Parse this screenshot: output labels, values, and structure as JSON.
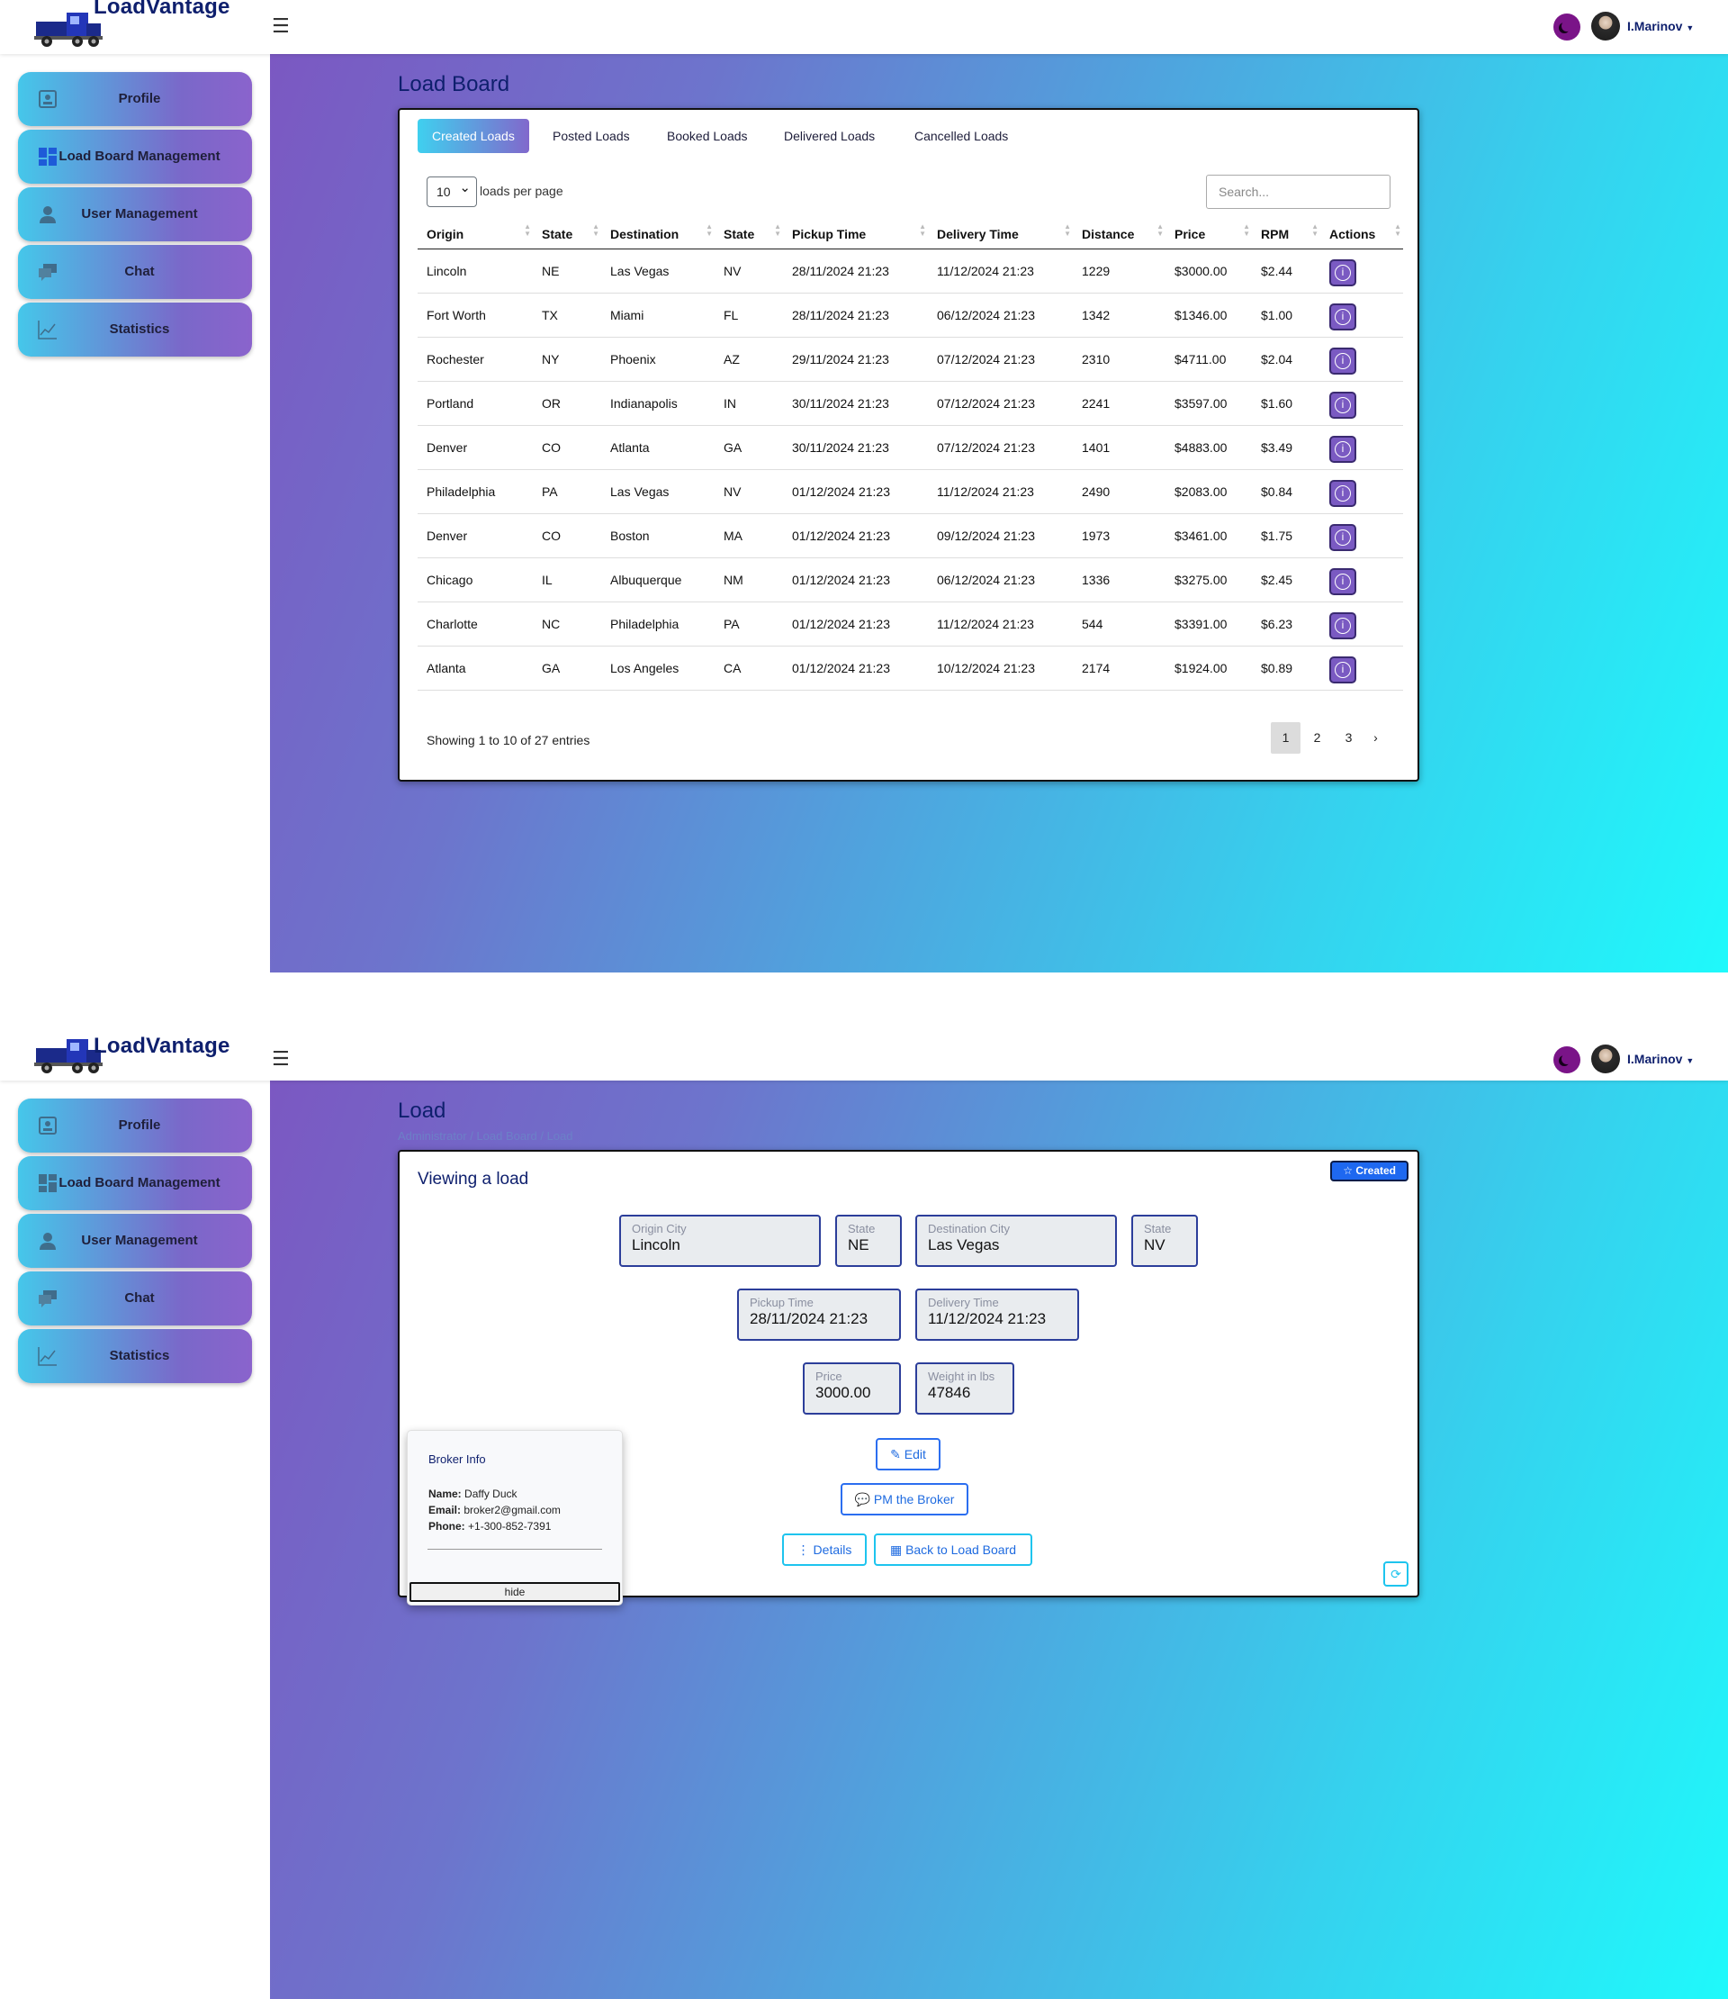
{
  "app": {
    "brand": "LoadVantage",
    "username": "I.Marinov"
  },
  "sidebar": {
    "items": [
      {
        "label": "Profile",
        "icon": "profile-icon"
      },
      {
        "label": "Load Board Management",
        "icon": "grid-icon"
      },
      {
        "label": "User Management",
        "icon": "user-icon"
      },
      {
        "label": "Chat",
        "icon": "chat-icon"
      },
      {
        "label": "Statistics",
        "icon": "chart-icon"
      }
    ]
  },
  "loadboard": {
    "title": "Load Board",
    "tabs": [
      "Created Loads",
      "Posted Loads",
      "Booked Loads",
      "Delivered Loads",
      "Cancelled Loads"
    ],
    "per_page_value": "10",
    "per_page_label": "loads per page",
    "search_placeholder": "Search...",
    "columns": [
      "Origin",
      "State",
      "Destination",
      "State",
      "Pickup Time",
      "Delivery Time",
      "Distance",
      "Price",
      "RPM",
      "Actions"
    ],
    "rows": [
      [
        "Lincoln",
        "NE",
        "Las Vegas",
        "NV",
        "28/11/2024 21:23",
        "11/12/2024 21:23",
        "1229",
        "$3000.00",
        "$2.44"
      ],
      [
        "Fort Worth",
        "TX",
        "Miami",
        "FL",
        "28/11/2024 21:23",
        "06/12/2024 21:23",
        "1342",
        "$1346.00",
        "$1.00"
      ],
      [
        "Rochester",
        "NY",
        "Phoenix",
        "AZ",
        "29/11/2024 21:23",
        "07/12/2024 21:23",
        "2310",
        "$4711.00",
        "$2.04"
      ],
      [
        "Portland",
        "OR",
        "Indianapolis",
        "IN",
        "30/11/2024 21:23",
        "07/12/2024 21:23",
        "2241",
        "$3597.00",
        "$1.60"
      ],
      [
        "Denver",
        "CO",
        "Atlanta",
        "GA",
        "30/11/2024 21:23",
        "07/12/2024 21:23",
        "1401",
        "$4883.00",
        "$3.49"
      ],
      [
        "Philadelphia",
        "PA",
        "Las Vegas",
        "NV",
        "01/12/2024 21:23",
        "11/12/2024 21:23",
        "2490",
        "$2083.00",
        "$0.84"
      ],
      [
        "Denver",
        "CO",
        "Boston",
        "MA",
        "01/12/2024 21:23",
        "09/12/2024 21:23",
        "1973",
        "$3461.00",
        "$1.75"
      ],
      [
        "Chicago",
        "IL",
        "Albuquerque",
        "NM",
        "01/12/2024 21:23",
        "06/12/2024 21:23",
        "1336",
        "$3275.00",
        "$2.45"
      ],
      [
        "Charlotte",
        "NC",
        "Philadelphia",
        "PA",
        "01/12/2024 21:23",
        "11/12/2024 21:23",
        "544",
        "$3391.00",
        "$6.23"
      ],
      [
        "Atlanta",
        "GA",
        "Los Angeles",
        "CA",
        "01/12/2024 21:23",
        "10/12/2024 21:23",
        "2174",
        "$1924.00",
        "$0.89"
      ]
    ],
    "showing": "Showing 1 to 10 of 27 entries",
    "pages": [
      "1",
      "2",
      "3"
    ],
    "next": "›"
  },
  "load": {
    "title": "Load",
    "breadcrumb": [
      "Administrator",
      "/",
      "Load Board",
      "/",
      "Load"
    ],
    "card_title": "Viewing a load",
    "status": "Created",
    "fields": {
      "origin_city": {
        "label": "Origin City",
        "value": "Lincoln"
      },
      "origin_state": {
        "label": "State",
        "value": "NE"
      },
      "destination_city": {
        "label": "Destination City",
        "value": "Las Vegas"
      },
      "destination_state": {
        "label": "State",
        "value": "NV"
      },
      "pickup_time": {
        "label": "Pickup Time",
        "value": "28/11/2024 21:23"
      },
      "delivery_time": {
        "label": "Delivery Time",
        "value": "11/12/2024 21:23"
      },
      "price": {
        "label": "Price",
        "value": "3000.00"
      },
      "weight": {
        "label": "Weight in lbs",
        "value": "47846"
      }
    },
    "buttons": {
      "edit": "Edit",
      "pm": "PM the Broker",
      "details": "Details",
      "back": "Back to Load Board"
    },
    "broker": {
      "title": "Broker Info",
      "name_label": "Name:",
      "name": "Daffy Duck",
      "email_label": "Email:",
      "email": "broker2@gmail.com",
      "phone_label": "Phone:",
      "phone": "+1-300-852-7391",
      "hide": "hide"
    }
  }
}
